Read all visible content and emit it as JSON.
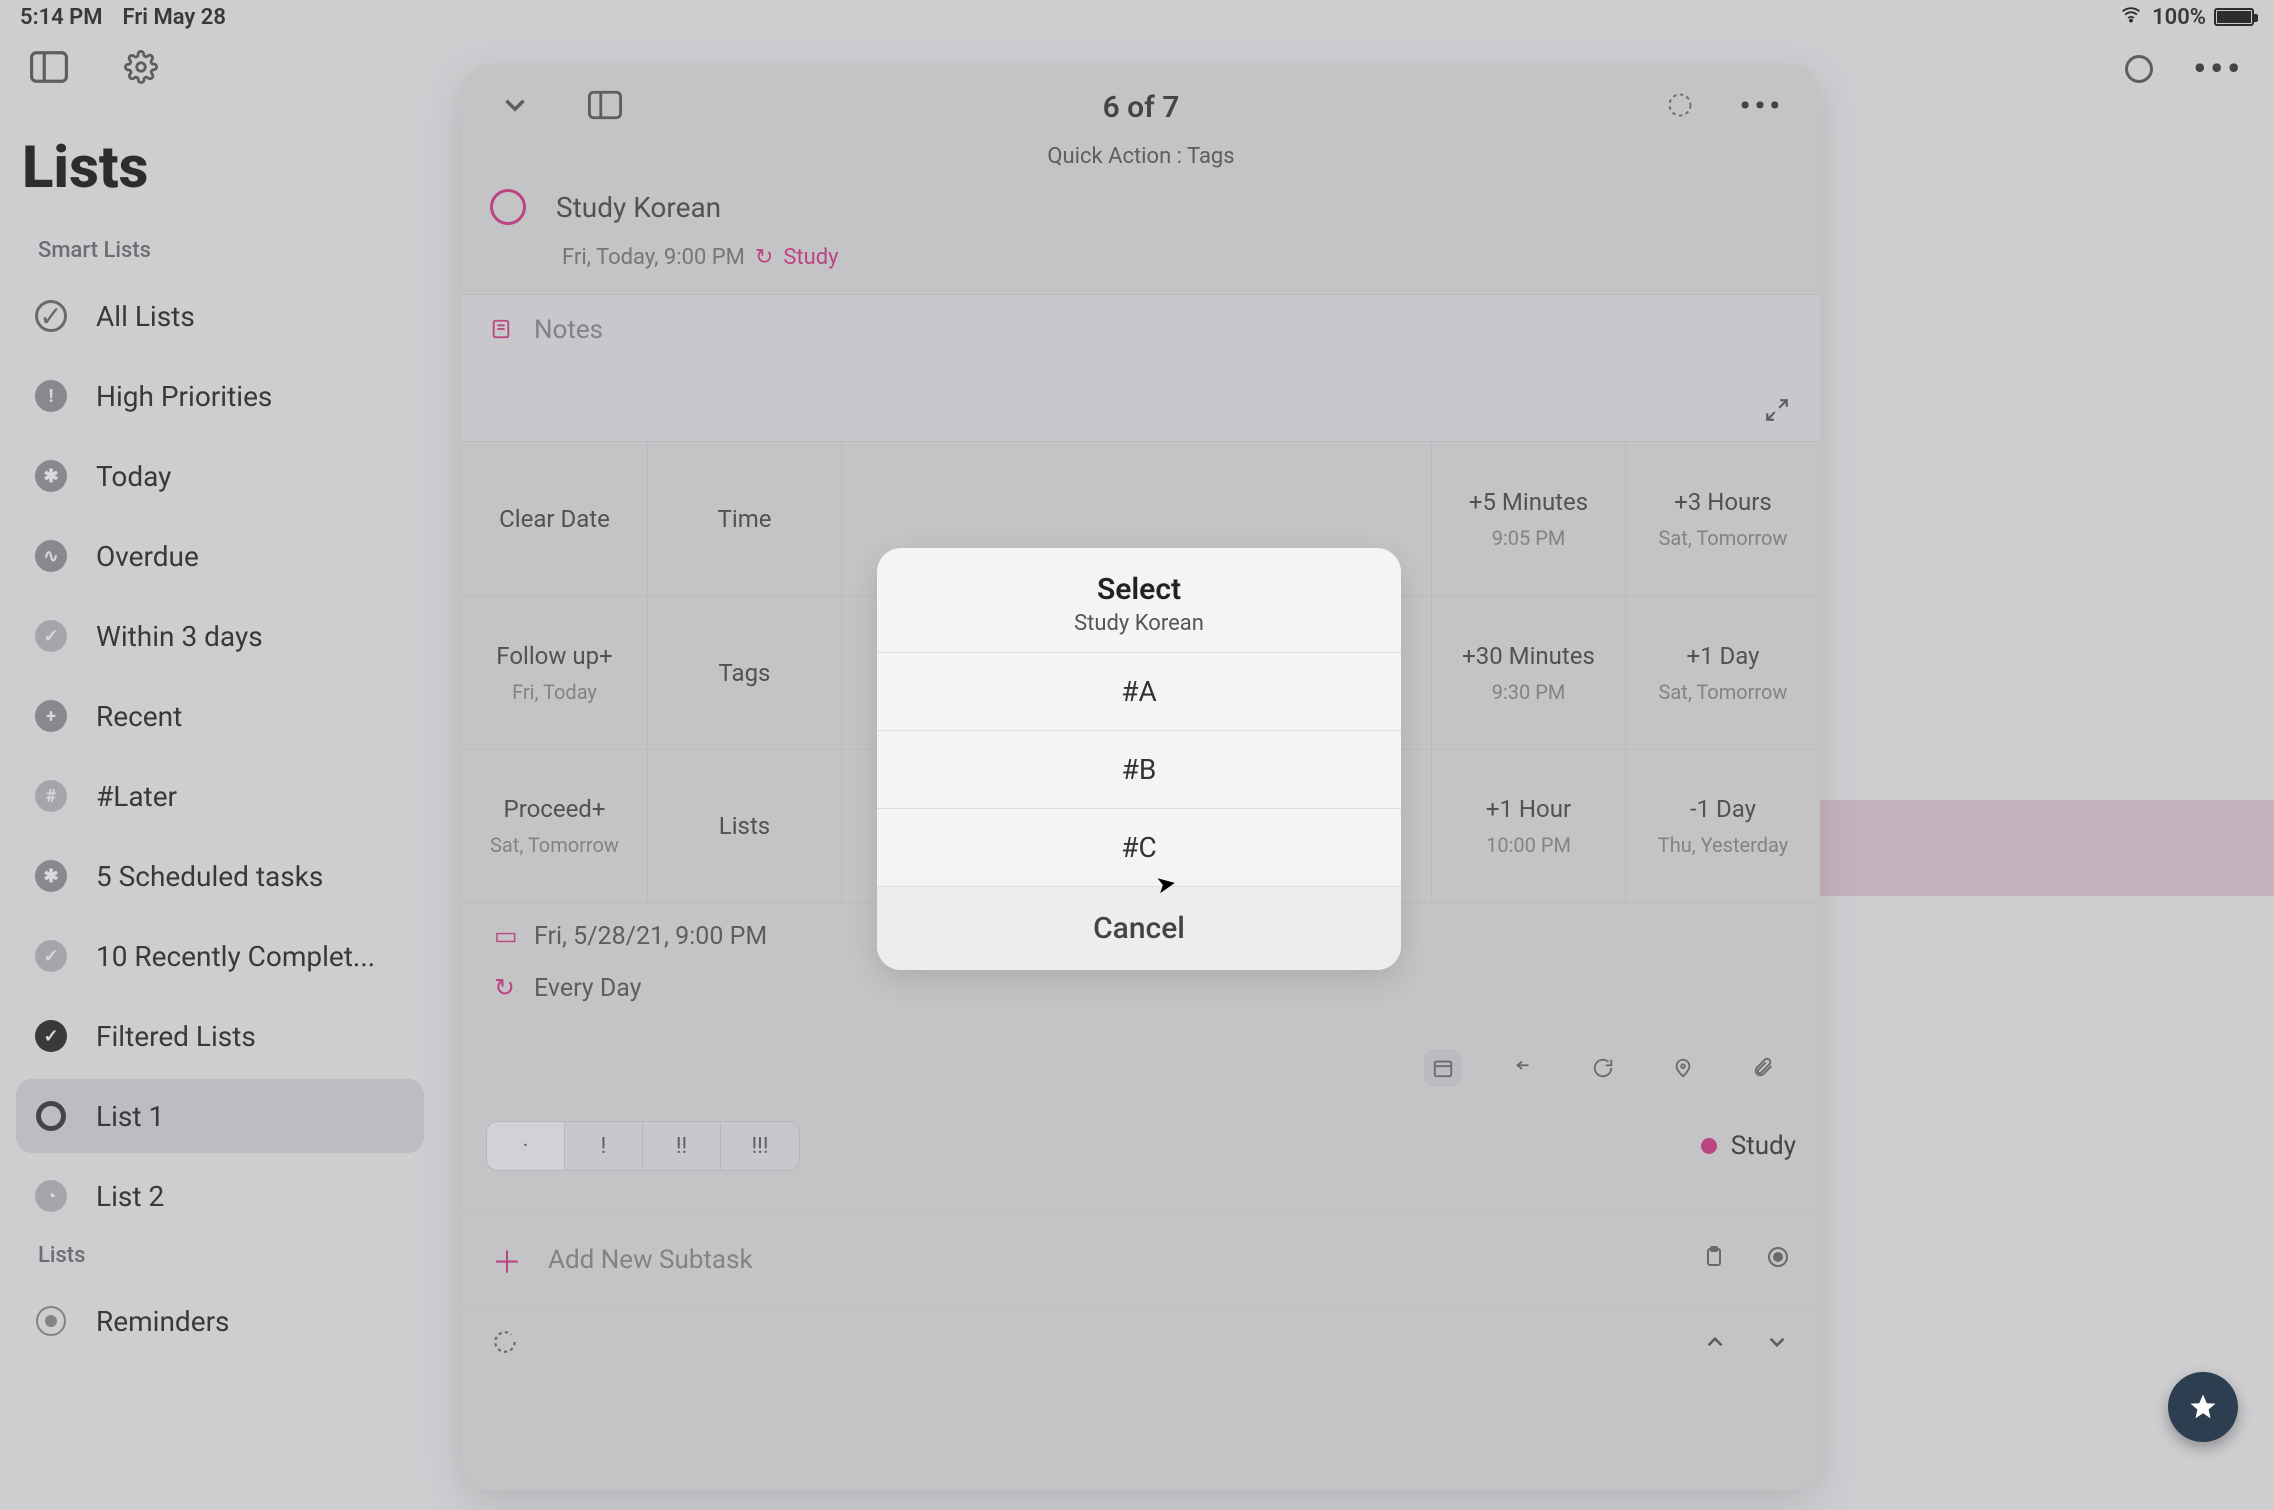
{
  "status": {
    "time": "5:14 PM",
    "date": "Fri May 28",
    "battery": "100%"
  },
  "sidebar": {
    "title": "Lists",
    "section1": "Smart Lists",
    "section2": "Lists",
    "items": [
      {
        "label": "All Lists"
      },
      {
        "label": "High Priorities"
      },
      {
        "label": "Today"
      },
      {
        "label": "Overdue"
      },
      {
        "label": "Within 3 days"
      },
      {
        "label": "Recent"
      },
      {
        "label": "#Later"
      },
      {
        "label": "5 Scheduled tasks"
      },
      {
        "label": "10 Recently Complet..."
      },
      {
        "label": "Filtered Lists"
      },
      {
        "label": "List 1"
      },
      {
        "label": "List 2"
      }
    ],
    "reminders": "Reminders"
  },
  "detail": {
    "counter": "6 of 7",
    "quick_action": "Quick Action : Tags",
    "task": "Study Korean",
    "schedule": "Fri, Today, 9:00 PM",
    "repeat_tag": "Study",
    "notes": "Notes",
    "grid": {
      "clear_date": "Clear Date",
      "time": "Time",
      "follow": "Follow up+",
      "follow_sub": "Fri, Today",
      "tags": "Tags",
      "proceed": "Proceed+",
      "proceed_sub": "Sat, Tomorrow",
      "lists": "Lists",
      "m5": "+5 Minutes",
      "m5_sub": "9:05 PM",
      "h3": "+3 Hours",
      "h3_sub": "Sat, Tomorrow",
      "m30": "+30 Minutes",
      "m30_sub": "9:30 PM",
      "d1": "+1 Day",
      "d1_sub": "Sat, Tomorrow",
      "h1": "+1 Hour",
      "h1_sub": "10:00 PM",
      "dm1": "-1 Day",
      "dm1_sub": "Thu, Yesterday"
    },
    "date_full": "Fri, 5/28/21, 9:00 PM",
    "repeat": "Every Day",
    "priority": {
      "none": "·",
      "p1": "!",
      "p2": "!!",
      "p3": "!!!"
    },
    "list_name": "Study",
    "subtask_placeholder": "Add New Subtask"
  },
  "modal": {
    "title": "Select",
    "subtitle": "Study Korean",
    "opt_a": "#A",
    "opt_b": "#B",
    "opt_c": "#C",
    "cancel": "Cancel"
  }
}
